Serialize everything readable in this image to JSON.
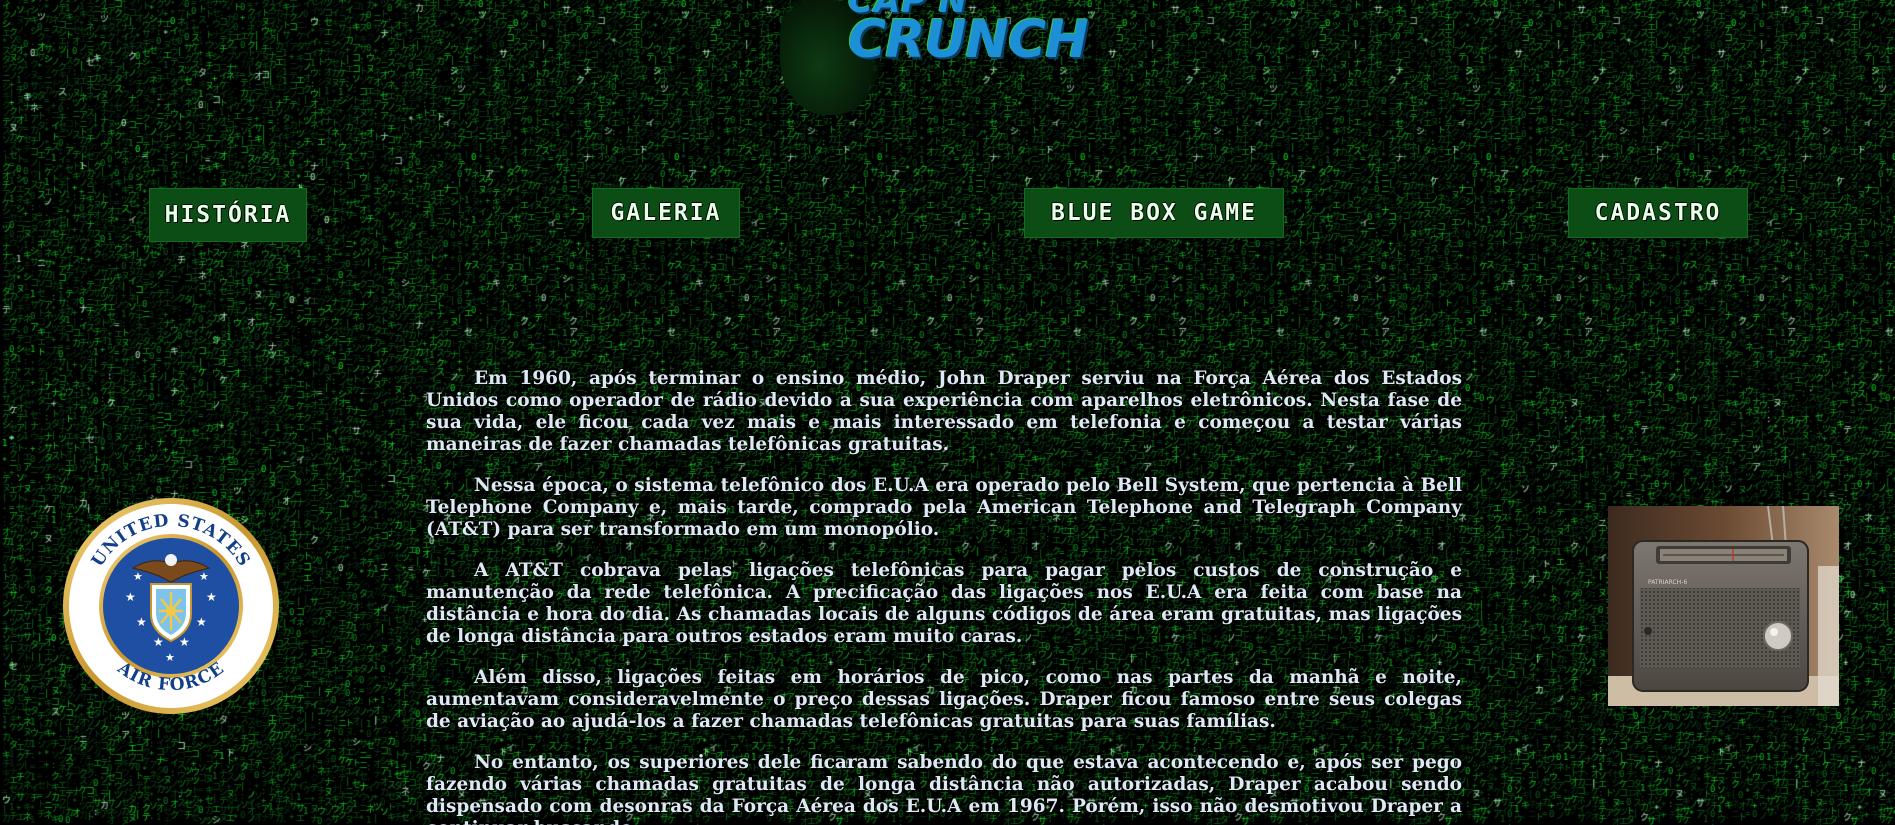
{
  "logo": {
    "line1": "CAP'N",
    "line2": "CRUNCH"
  },
  "nav": {
    "historia": "HISTÓRIA",
    "galeria": "GALERIA",
    "bluebox": "BLUE BOX GAME",
    "cadastro": "CADASTRO"
  },
  "seal": {
    "top_text": "UNITED STATES",
    "bottom_text": "AIR FORCE"
  },
  "radio": {
    "brand": "PATRIARCH-6"
  },
  "content": {
    "paragraphs": [
      "Em 1960, após terminar o ensino médio, John Draper serviu na Força Aérea dos Estados Unidos como operador de rádio devido a sua experiência com aparelhos eletrônicos. Nesta fase de sua vida, ele ficou cada vez mais e mais interessado em telefonia e começou a testar várias maneiras de fazer chamadas telefônicas gratuitas.",
      "Nessa época, o sistema telefônico dos E.U.A era operado pelo Bell System, que pertencia à Bell Telephone Company e, mais tarde, comprado pela American Telephone and Telegraph Company (AT&T) para ser transformado em um monopólio.",
      "A AT&T cobrava pelas ligações telefônicas para pagar pelos custos de construção e manutenção da rede telefônica. A precificação das ligações nos E.U.A era feita com base na distância e hora do dia. As chamadas locais de alguns códigos de área eram gratuitas, mas ligações de longa distância para outros estados eram muito caras.",
      "Além disso, ligações feitas em horários de pico, como nas partes da manhã e noite, aumentavam consideravelmente o preço dessas ligações. Draper ficou famoso entre seus colegas de aviação ao ajudá-los a fazer chamadas telefônicas gratuitas para suas famílias.",
      "No entanto, os superiores dele ficaram sabendo do que estava acontecendo e, após ser pego fazendo várias chamadas gratuitas de longa distância não autorizadas, Draper acabou sendo dispensado com desonras da Força Aérea dos E.U.A em 1967. Porém, isso não desmotivou Draper a continuar buscando"
    ]
  }
}
